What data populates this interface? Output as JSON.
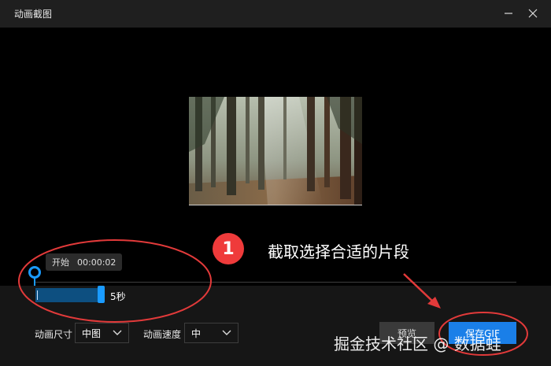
{
  "window": {
    "title": "动画截图",
    "minimize_icon": "minimize-icon",
    "close_icon": "close-icon"
  },
  "annotation": {
    "marker": "1",
    "text": "截取选择合适的片段",
    "color": "#ef3b3b"
  },
  "timeline": {
    "start_label": "开始",
    "start_time": "00:00:02",
    "duration": "5秒",
    "accent": "#1a9bff"
  },
  "settings": {
    "size_label": "动画尺寸",
    "size_value": "中图",
    "speed_label": "动画速度",
    "speed_value": "中"
  },
  "actions": {
    "preview_label": "预览",
    "save_label": "保存GIF"
  },
  "watermark": "掘金技术社区 @ 数据蛙"
}
